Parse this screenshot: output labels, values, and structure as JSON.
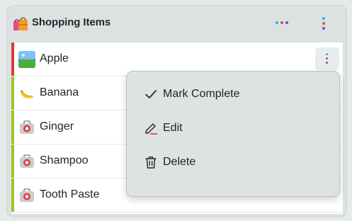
{
  "header": {
    "title": "Shopping Items",
    "icon": "shopping-bags-icon",
    "dot_colors": [
      "#3ab0d8",
      "#e04a4a",
      "#7b4ad8"
    ]
  },
  "items": [
    {
      "label": "Apple",
      "icon": "landscape-photo-icon",
      "accent": "#d83a3a"
    },
    {
      "label": "Banana",
      "icon": "banana-icon",
      "accent": "#a6bf2a"
    },
    {
      "label": "Ginger",
      "icon": "first-aid-kit-icon",
      "accent": "#a6bf2a"
    },
    {
      "label": "Shampoo",
      "icon": "first-aid-kit-icon",
      "accent": "#a6bf2a"
    },
    {
      "label": "Tooth Paste",
      "icon": "first-aid-kit-icon",
      "accent": "#a6bf2a"
    }
  ],
  "context_menu": {
    "items": [
      {
        "label": "Mark Complete",
        "icon": "check-icon"
      },
      {
        "label": "Edit",
        "icon": "pencil-icon"
      },
      {
        "label": "Delete",
        "icon": "trash-icon"
      }
    ]
  }
}
